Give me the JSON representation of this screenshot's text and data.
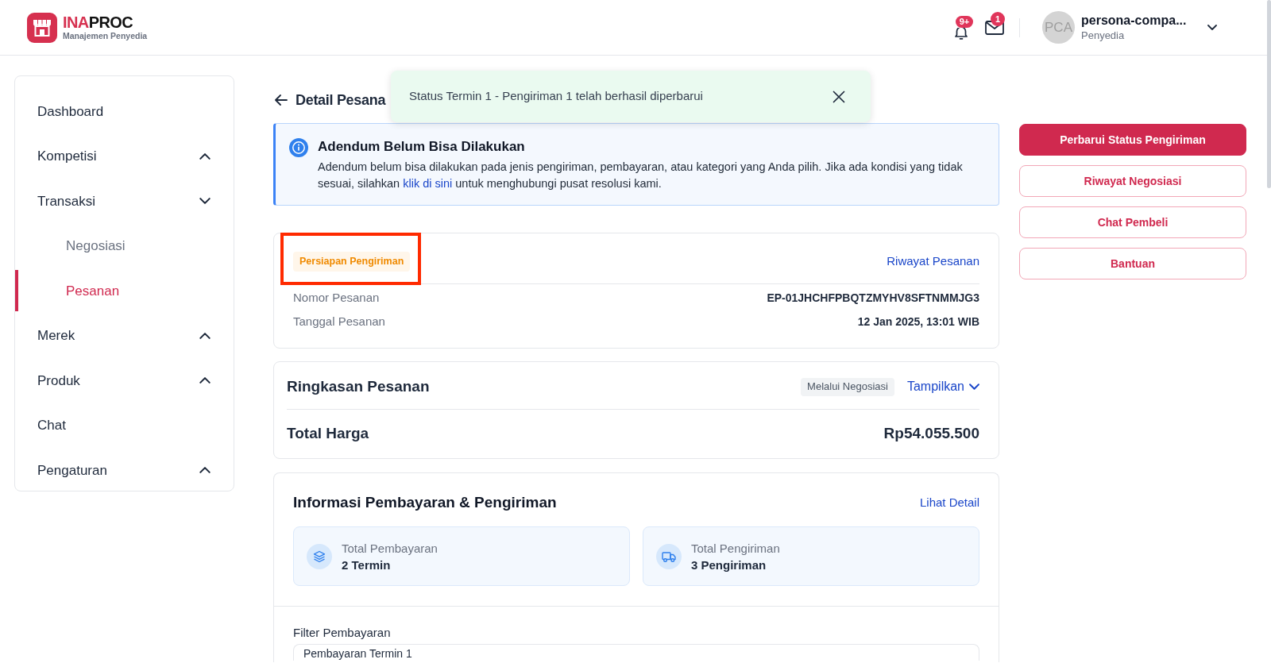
{
  "header": {
    "brand": {
      "accent": "INA",
      "rest": "PROC",
      "subtitle": "Manajemen Penyedia"
    },
    "notifications": {
      "count": "9+"
    },
    "messages": {
      "count": "1"
    },
    "user": {
      "initials": "PCA",
      "name": "persona-compa...",
      "role": "Penyedia"
    }
  },
  "sidebar": {
    "items": [
      {
        "kind": "link",
        "label": "Dashboard",
        "selected": false
      },
      {
        "kind": "group",
        "label": "Kompetisi",
        "selected": false,
        "expanded": false
      },
      {
        "kind": "group",
        "label": "Transaksi",
        "selected": false,
        "expanded": true,
        "children": [
          {
            "label": "Negosiasi",
            "selected": false
          },
          {
            "label": "Pesanan",
            "selected": true
          }
        ]
      },
      {
        "kind": "group",
        "label": "Merek",
        "selected": false,
        "expanded": false
      },
      {
        "kind": "group",
        "label": "Produk",
        "selected": false,
        "expanded": false
      },
      {
        "kind": "link",
        "label": "Chat",
        "selected": false
      },
      {
        "kind": "group",
        "label": "Pengaturan",
        "selected": false,
        "expanded": false
      }
    ]
  },
  "page": {
    "title": "Detail Pesana"
  },
  "toast": {
    "message": "Status Termin 1 - Pengiriman 1 telah berhasil diperbarui"
  },
  "alert": {
    "title": "Adendum Belum Bisa Dilakukan",
    "text_before": "Adendum belum bisa dilakukan pada jenis pengiriman, pembayaran, atau kategori yang Anda pilih. Jika ada kondisi yang tidak sesuai, silahkan ",
    "link": "klik di sini",
    "text_after": " untuk menghubungi pusat resolusi kami."
  },
  "order": {
    "status": "Persiapan Pengiriman",
    "highlighted": true,
    "history_link": "Riwayat Pesanan",
    "fields": [
      {
        "label": "Nomor Pesanan",
        "value": "EP-01JHCHFPBQTZMYHV8SFTNMMJG3"
      },
      {
        "label": "Tanggal Pesanan",
        "value": "12 Jan 2025, 13:01 WIB"
      }
    ]
  },
  "summary": {
    "title": "Ringkasan Pesanan",
    "tag": "Melalui Negosiasi",
    "toggle": "Tampilkan",
    "expanded": false,
    "total_label": "Total Harga",
    "total_value": "Rp54.055.500"
  },
  "payment": {
    "title": "Informasi Pembayaran & Pengiriman",
    "detail_link": "Lihat Detail",
    "stats": [
      {
        "kind": "payment",
        "label": "Total Pembayaran",
        "value": "2 Termin"
      },
      {
        "kind": "shipping",
        "label": "Total Pengiriman",
        "value": "3 Pengiriman"
      }
    ],
    "filter": {
      "label": "Filter Pembayaran",
      "value": "Pembayaran Termin 1"
    }
  },
  "actions": [
    {
      "kind": "primary",
      "label": "Perbarui Status Pengiriman"
    },
    {
      "kind": "outline",
      "label": "Riwayat Negosiasi"
    },
    {
      "kind": "outline",
      "label": "Chat Pembeli"
    },
    {
      "kind": "outline",
      "label": "Bantuan"
    }
  ]
}
